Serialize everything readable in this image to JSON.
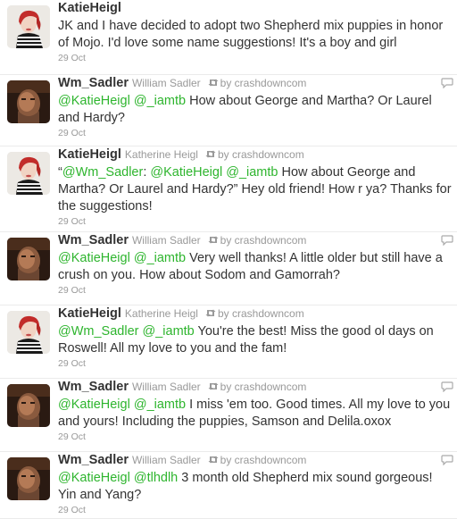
{
  "tweets": [
    {
      "id": "t1",
      "avatar": "katie",
      "screen_name": "KatieHeigl",
      "full_name": "",
      "rt_icon": "retweet-icon",
      "by": "",
      "show_reply": false,
      "segments": [
        {
          "type": "text",
          "value": "JK and I have decided to adopt two Shepherd mix puppies in honor of Mojo. I'd love some name suggestions! It's a boy and girl"
        }
      ],
      "date": "29 Oct"
    },
    {
      "id": "t2",
      "avatar": "sadler",
      "screen_name": "Wm_Sadler",
      "full_name": "William Sadler",
      "rt_icon": "retweet-icon",
      "by": "by crashdowncom",
      "show_reply": true,
      "segments": [
        {
          "type": "mention",
          "value": "@KatieHeigl"
        },
        {
          "type": "text",
          "value": " "
        },
        {
          "type": "mention",
          "value": "@_iamtb"
        },
        {
          "type": "text",
          "value": " How about George and Martha? Or Laurel and Hardy?"
        }
      ],
      "date": "29 Oct"
    },
    {
      "id": "t3",
      "avatar": "katie",
      "screen_name": "KatieHeigl",
      "full_name": "Katherine Heigl",
      "rt_icon": "retweet-icon",
      "by": "by crashdowncom",
      "show_reply": false,
      "segments": [
        {
          "type": "text",
          "value": "“"
        },
        {
          "type": "mention",
          "value": "@Wm_Sadler"
        },
        {
          "type": "text",
          "value": ": "
        },
        {
          "type": "mention",
          "value": "@KatieHeigl"
        },
        {
          "type": "text",
          "value": " "
        },
        {
          "type": "mention",
          "value": "@_iamtb"
        },
        {
          "type": "text",
          "value": " How about George and Martha? Or Laurel and Hardy?” Hey old friend! How r ya? Thanks for the suggestions!"
        }
      ],
      "date": "29 Oct"
    },
    {
      "id": "t4",
      "avatar": "sadler",
      "screen_name": "Wm_Sadler",
      "full_name": "William Sadler",
      "rt_icon": "retweet-icon",
      "by": "by crashdowncom",
      "show_reply": true,
      "segments": [
        {
          "type": "mention",
          "value": "@KatieHeigl"
        },
        {
          "type": "text",
          "value": " "
        },
        {
          "type": "mention",
          "value": "@_iamtb"
        },
        {
          "type": "text",
          "value": " Very well thanks! A little older but still have a crush on you. How about Sodom and Gamorrah?"
        }
      ],
      "date": "29 Oct"
    },
    {
      "id": "t5",
      "avatar": "katie",
      "screen_name": "KatieHeigl",
      "full_name": "Katherine Heigl",
      "rt_icon": "retweet-icon",
      "by": "by crashdowncom",
      "show_reply": false,
      "segments": [
        {
          "type": "mention",
          "value": "@Wm_Sadler"
        },
        {
          "type": "text",
          "value": " "
        },
        {
          "type": "mention",
          "value": "@_iamtb"
        },
        {
          "type": "text",
          "value": " You're the best! Miss the good ol days on Roswell! All my love to you and the fam!"
        }
      ],
      "date": "29 Oct"
    },
    {
      "id": "t6",
      "avatar": "sadler",
      "screen_name": "Wm_Sadler",
      "full_name": "William Sadler",
      "rt_icon": "retweet-icon",
      "by": "by crashdowncom",
      "show_reply": true,
      "segments": [
        {
          "type": "mention",
          "value": "@KatieHeigl"
        },
        {
          "type": "text",
          "value": " "
        },
        {
          "type": "mention",
          "value": "@_iamtb"
        },
        {
          "type": "text",
          "value": " I miss 'em too. Good times. All my love to you and yours! Including the puppies, Samson and Delila.oxox"
        }
      ],
      "date": "29 Oct"
    },
    {
      "id": "t7",
      "avatar": "sadler",
      "screen_name": "Wm_Sadler",
      "full_name": "William Sadler",
      "rt_icon": "retweet-icon",
      "by": "by crashdowncom",
      "show_reply": true,
      "segments": [
        {
          "type": "mention",
          "value": "@KatieHeigl"
        },
        {
          "type": "text",
          "value": " "
        },
        {
          "type": "mention",
          "value": "@tlhdlh"
        },
        {
          "type": "text",
          "value": " 3 month old Shepherd mix sound gorgeous! Yin and Yang?"
        }
      ],
      "date": "29 Oct"
    }
  ],
  "colors": {
    "mention": "#2eb52e",
    "text": "#333333",
    "meta": "#999999"
  }
}
